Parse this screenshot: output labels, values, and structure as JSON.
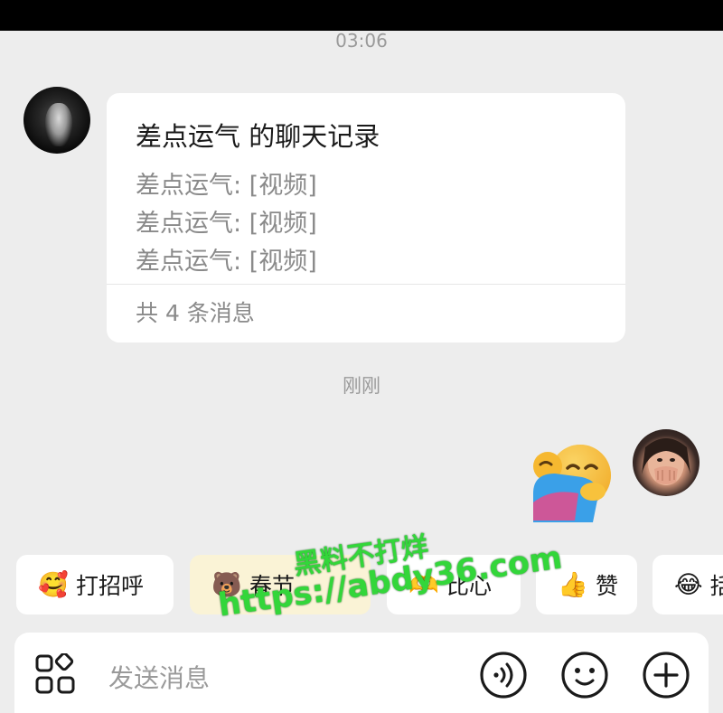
{
  "status_time": "03:06",
  "card": {
    "title": "差点运气 的聊天记录",
    "lines": [
      "差点运气: [视频]",
      "差点运气: [视频]",
      "差点运气: [视频]"
    ],
    "footer": "共 4 条消息"
  },
  "mid_time": "刚刚",
  "sent_sticker": "hugging-face-emoji",
  "quick_replies": [
    {
      "emoji": "🥰",
      "label": "打招呼"
    },
    {
      "emoji": "🐻",
      "label": "春节"
    },
    {
      "emoji": "🫶",
      "label": "比心"
    },
    {
      "emoji": "👍",
      "label": "赞"
    },
    {
      "emoji": "😂",
      "label": "括"
    }
  ],
  "watermark": {
    "line1": "黑料不打烊",
    "line2": "https://abdy36.com"
  },
  "input": {
    "placeholder": "发送消息"
  },
  "icons": {
    "apps": "grid-apps-icon",
    "voice": "voice-icon",
    "emoji": "emoji-smile-icon",
    "add": "plus-icon"
  },
  "colors": {
    "background": "#ededed",
    "card": "#ffffff",
    "watermark": "#33d63a"
  }
}
